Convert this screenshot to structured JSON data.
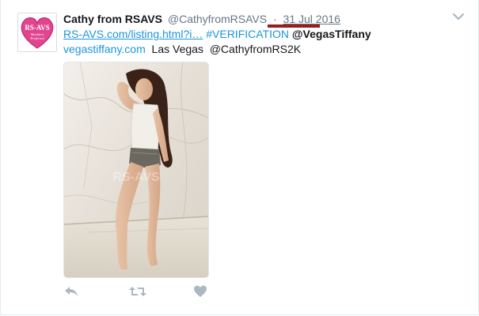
{
  "tweet": {
    "author": {
      "display_name": "Cathy from RSAVS",
      "handle": "@CathyfromRSAVS",
      "avatar_text_top": "RS-AVS",
      "avatar_text_sub1": "Members",
      "avatar_text_sub2": "Preferred"
    },
    "separator": "·",
    "date": "31 Jul 2016",
    "text": {
      "url": "RS-AVS.com/listing.html?i…",
      "hashtag": "#VERIFICATION",
      "mention1": "@VegasTiffany",
      "site": "vegastiffany.com",
      "location": "Las Vegas",
      "mention2": "@CathyfromRS2K"
    },
    "media": {
      "watermark": "RS-AVS"
    },
    "actions": [
      "reply-icon",
      "retweet-icon",
      "like-icon"
    ],
    "colors": {
      "link": "#1b95e0",
      "muted": "#657786",
      "highlight_underline": "#9b1c1c",
      "avatar_pink": "#e0458e"
    }
  }
}
